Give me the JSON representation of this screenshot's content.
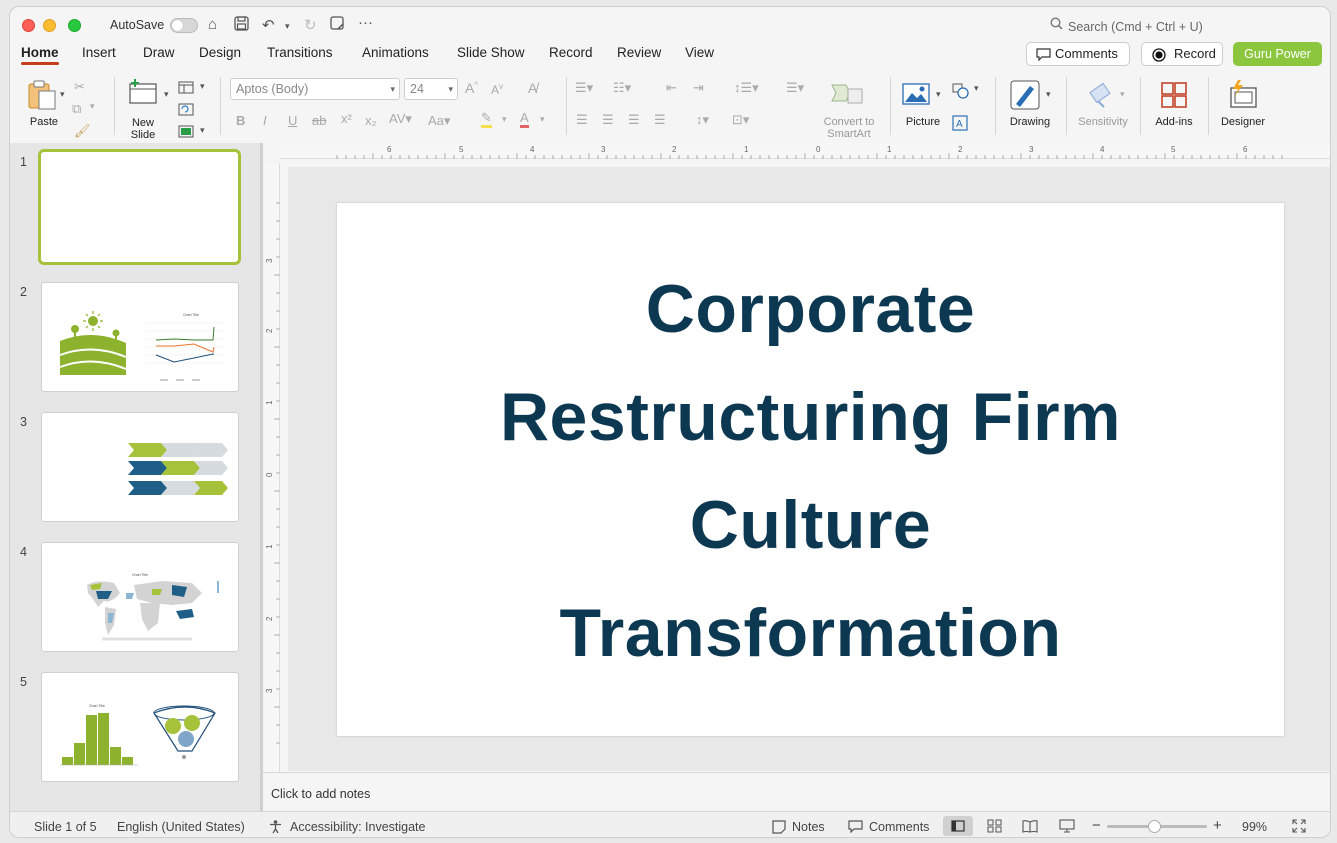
{
  "titlebar": {
    "autosave_label": "AutoSave",
    "search_placeholder": "Search (Cmd + Ctrl + U)"
  },
  "tabs": [
    {
      "label": "Home",
      "active": true
    },
    {
      "label": "Insert"
    },
    {
      "label": "Draw"
    },
    {
      "label": "Design"
    },
    {
      "label": "Transitions"
    },
    {
      "label": "Animations"
    },
    {
      "label": "Slide Show"
    },
    {
      "label": "Record"
    },
    {
      "label": "Review"
    },
    {
      "label": "View"
    }
  ],
  "header_buttons": {
    "comments": "Comments",
    "record": "Record",
    "guru": "Guru Power"
  },
  "ribbon": {
    "paste": "Paste",
    "new_slide_1": "New",
    "new_slide_2": "Slide",
    "font_name": "Aptos (Body)",
    "font_size": "24",
    "convert_1": "Convert to",
    "convert_2": "SmartArt",
    "picture": "Picture",
    "drawing": "Drawing",
    "sensitivity": "Sensitivity",
    "addins": "Add-ins",
    "designer": "Designer"
  },
  "thumbnails": [
    "1",
    "2",
    "3",
    "4",
    "5"
  ],
  "slide": {
    "title_lines": [
      "Corporate",
      "Restructuring Firm",
      "Culture",
      "Transformation"
    ]
  },
  "notes": {
    "placeholder": "Click to add notes"
  },
  "status": {
    "slide_info": "Slide 1 of 5",
    "language": "English (United States)",
    "accessibility": "Accessibility: Investigate",
    "notes": "Notes",
    "comments": "Comments",
    "zoom": "99%"
  },
  "colors": {
    "accent_green": "#8cc63f",
    "title_navy": "#0d3852",
    "tab_underline": "#c43e1c"
  }
}
